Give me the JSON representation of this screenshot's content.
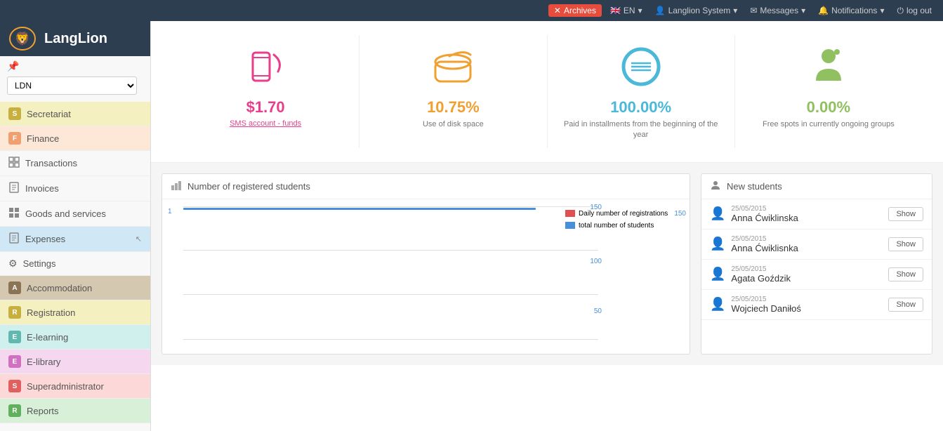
{
  "topbar": {
    "archives_label": "Archives",
    "lang_label": "EN",
    "user_label": "Langlion System",
    "messages_label": "Messages",
    "notifications_label": "Notifications",
    "logout_label": "log out",
    "close_icon": "✕"
  },
  "sidebar": {
    "logo_text": "LangLion",
    "location_value": "LDN",
    "nav_items": [
      {
        "id": "secretariat",
        "label": "Secretariat",
        "badge": "S",
        "badge_color": "#e8d44d"
      },
      {
        "id": "finance",
        "label": "Finance",
        "badge": "F",
        "badge_color": "#f0a070"
      },
      {
        "id": "transactions",
        "label": "Transactions",
        "icon": "⊞"
      },
      {
        "id": "invoices",
        "label": "Invoices",
        "icon": "▤"
      },
      {
        "id": "goods",
        "label": "Goods and services",
        "icon": "▦"
      },
      {
        "id": "expenses",
        "label": "Expenses",
        "icon": "▤",
        "active": true
      },
      {
        "id": "settings",
        "label": "Settings",
        "icon": "⚙"
      },
      {
        "id": "accommodation",
        "label": "Accommodation",
        "badge": "A",
        "badge_color": "#8B7355"
      },
      {
        "id": "registration",
        "label": "Registration",
        "badge": "R",
        "badge_color": "#c8b040"
      },
      {
        "id": "elearning",
        "label": "E-learning",
        "badge": "E",
        "badge_color": "#60b8b0"
      },
      {
        "id": "elibrary",
        "label": "E-library",
        "badge": "E",
        "badge_color": "#d070c0"
      },
      {
        "id": "superadmin",
        "label": "Superadministrator",
        "badge": "S",
        "badge_color": "#e06060"
      },
      {
        "id": "reports",
        "label": "Reports",
        "badge": "R",
        "badge_color": "#60b060"
      }
    ]
  },
  "stats": [
    {
      "id": "sms",
      "value": "$1.70",
      "value_color": "#e83e8c",
      "label": "SMS account - funds",
      "is_link": true,
      "icon_type": "sms"
    },
    {
      "id": "disk",
      "value": "10.75%",
      "value_color": "#f0a030",
      "label": "Use of disk space",
      "is_link": false,
      "icon_type": "disk"
    },
    {
      "id": "installments",
      "value": "100.00%",
      "value_color": "#4ab8d8",
      "label": "Paid in installments from the beginning of the year",
      "is_link": false,
      "icon_type": "installments"
    },
    {
      "id": "spots",
      "value": "0.00%",
      "value_color": "#90c060",
      "label": "Free spots in currently ongoing groups",
      "is_link": false,
      "icon_type": "people"
    }
  ],
  "chart": {
    "title": "Number of registered students",
    "y_labels": [
      "150",
      "100",
      "50"
    ],
    "bar_value": 1,
    "legend": [
      {
        "label": "Daily number of registrations",
        "color": "#e05050",
        "value": "150"
      },
      {
        "label": "total number of students",
        "color": "#4a90d9"
      }
    ]
  },
  "new_students": {
    "title": "New students",
    "items": [
      {
        "date": "25/05/2015",
        "name": "Anna Ćwiklinska",
        "show_label": "Show"
      },
      {
        "date": "25/05/2015",
        "name": "Anna Ćwiklisnka",
        "show_label": "Show"
      },
      {
        "date": "25/05/2015",
        "name": "Agata Goździk",
        "show_label": "Show"
      },
      {
        "date": "25/05/2015",
        "name": "Wojciech Daniłoś",
        "show_label": "Show"
      }
    ]
  }
}
